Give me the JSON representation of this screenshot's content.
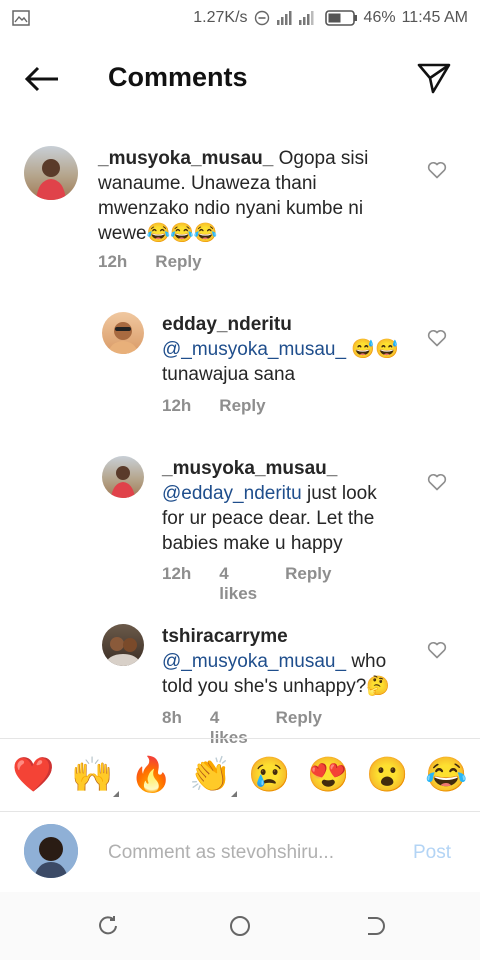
{
  "status_bar": {
    "speed": "1.27K/s",
    "battery": "46%",
    "time": "11:45 AM"
  },
  "header": {
    "title": "Comments"
  },
  "comments": [
    {
      "username": "_musyoka_musau_",
      "text": " Ogopa sisi wanaume. Unaweza thani mwenzako ndio nyani kumbe ni wewe😂😂😂",
      "time": "12h",
      "reply": "Reply"
    },
    {
      "username": "edday_nderitu",
      "mention": "@_musyoka_musau_",
      "text": " 😅😅tunawajua sana",
      "time": "12h",
      "reply": "Reply"
    },
    {
      "username": "_musyoka_musau_",
      "mention": "@edday_nderitu",
      "text": " just look for ur peace dear. Let the babies make u happy",
      "time": "12h",
      "likes": "4 likes",
      "reply": "Reply"
    },
    {
      "username": "tshiracarryme",
      "mention": " @_musyoka_musau_",
      "text": " who told you she's unhappy?🤔",
      "time": "8h",
      "likes": "4 likes",
      "reply": "Reply"
    }
  ],
  "emoji_bar": [
    "❤️",
    "🙌",
    "🔥",
    "👏",
    "😢",
    "😍",
    "😮",
    "😂"
  ],
  "composer": {
    "placeholder": "Comment as stevohshiru...",
    "post_label": "Post"
  },
  "colors": {
    "mention": "#1f4e8c",
    "meta": "#8e8e8e",
    "post_disabled": "#b3d4f5"
  }
}
